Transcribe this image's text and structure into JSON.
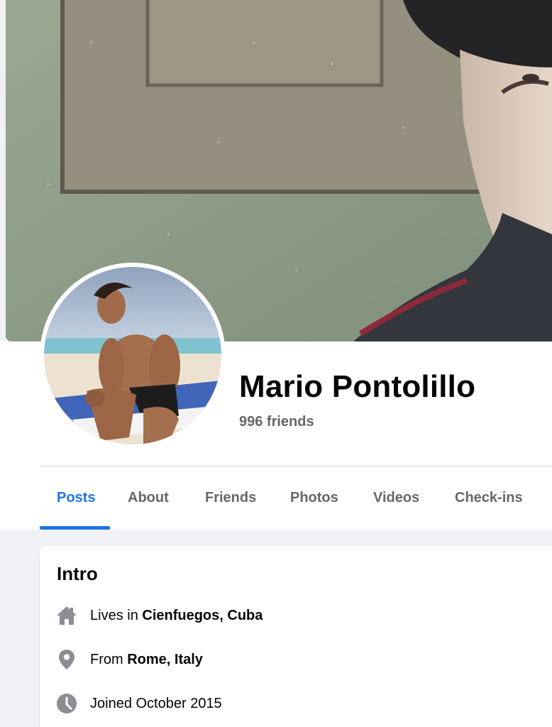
{
  "profile": {
    "name": "Mario Pontolillo",
    "friends": "996 friends"
  },
  "tabs": [
    {
      "label": "Posts",
      "active": true
    },
    {
      "label": "About",
      "active": false
    },
    {
      "label": "Friends",
      "active": false
    },
    {
      "label": "Photos",
      "active": false
    },
    {
      "label": "Videos",
      "active": false
    },
    {
      "label": "Check-ins",
      "active": false
    }
  ],
  "intro": {
    "title": "Intro",
    "lives": {
      "prefix": "Lives in ",
      "place": "Cienfuegos, Cuba",
      "icon": "home-icon"
    },
    "from": {
      "prefix": "From ",
      "place": "Rome, Italy",
      "icon": "location-pin-icon"
    },
    "joined": {
      "text": "Joined October 2015",
      "icon": "clock-icon"
    }
  },
  "colors": {
    "accent": "#1b74e4",
    "secondary_text": "#65676b",
    "icon_gray": "#8a8d91",
    "page_bg": "#f0f2f5"
  }
}
